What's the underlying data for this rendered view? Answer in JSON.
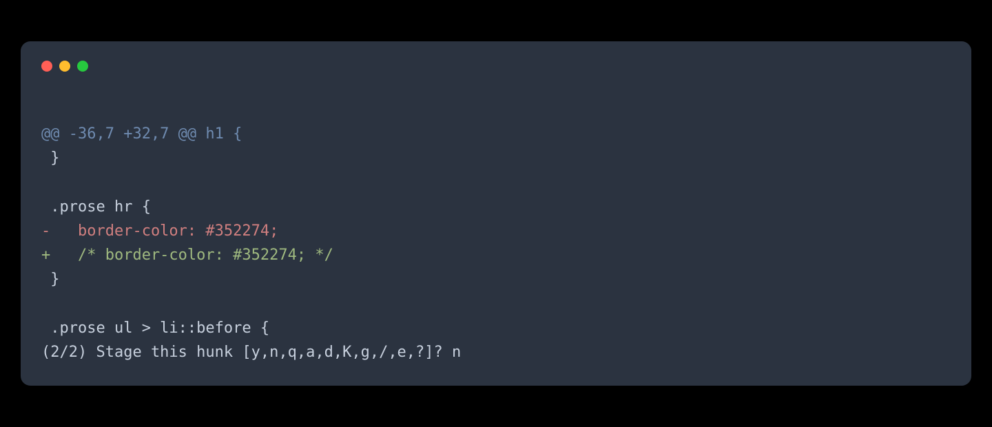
{
  "terminal": {
    "lines": {
      "diff_header": "@@ -36,7 +32,7 @@ h1 {",
      "context_1": " }",
      "blank_1": "",
      "context_2": " .prose hr {",
      "removed": "-   border-color: #352274;",
      "added": "+   /* border-color: #352274; */",
      "context_3": " }",
      "blank_2": "",
      "context_4": " .prose ul > li::before {",
      "prompt": "(2/2) Stage this hunk [y,n,q,a,d,K,g,/,e,?]? n"
    }
  },
  "colors": {
    "window_bg": "#2b3340",
    "body_bg": "#000000",
    "text_default": "#c7d0dd",
    "diff_header": "#6f8bb0",
    "diff_removed": "#d07f7f",
    "diff_added": "#9fb97f",
    "traffic_red": "#ff5f56",
    "traffic_yellow": "#ffbd2e",
    "traffic_green": "#27c93f"
  }
}
